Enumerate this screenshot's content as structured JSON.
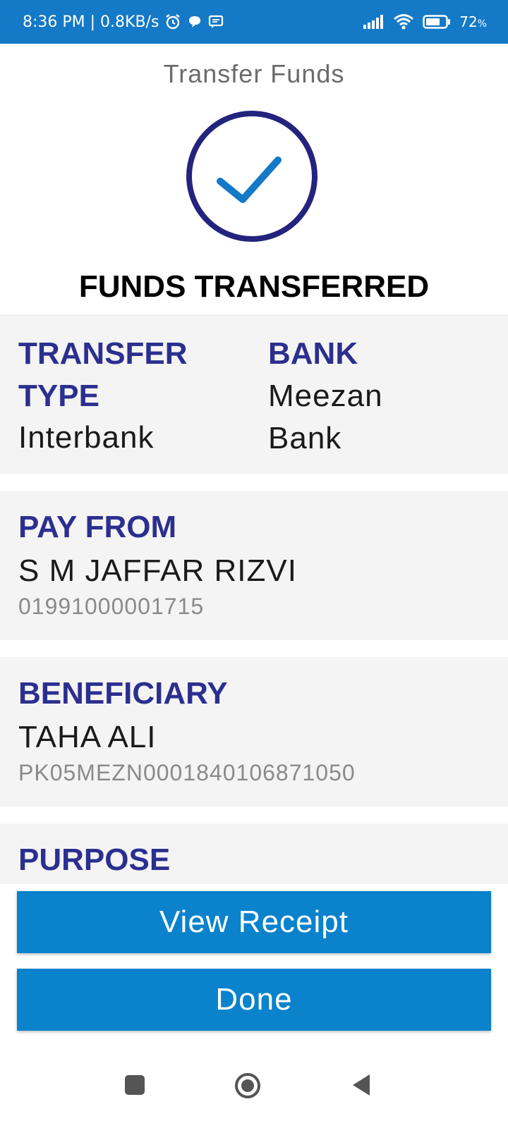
{
  "status_bar": {
    "time_speed": "8:36 PM | 0.8KB/s",
    "battery": "72",
    "battery_unit": "%"
  },
  "header": {
    "title": "Transfer Funds"
  },
  "success": {
    "headline": "FUNDS TRANSFERRED",
    "icon": "check-circle-icon"
  },
  "details": {
    "transfer_type_label_line1": "TRANSFER",
    "transfer_type_label_line2": "TYPE",
    "transfer_type_value": "Interbank",
    "bank_label": "BANK",
    "bank_value_line1": "Meezan",
    "bank_value_line2": "Bank",
    "pay_from_label": "PAY FROM",
    "pay_from_name": "S M JAFFAR RIZVI",
    "pay_from_account": "01991000001715",
    "beneficiary_label": "BENEFICIARY",
    "beneficiary_name": "TAHA ALI",
    "beneficiary_iban": "PK05MEZN0001840106871050",
    "purpose_label": "PURPOSE"
  },
  "buttons": {
    "view_receipt": "View Receipt",
    "done": "Done"
  },
  "colors": {
    "status_bar": "#1479c6",
    "accent": "#0a82cc",
    "label": "#2c2f8f",
    "check_ring": "#24237e",
    "check_mark": "#1479c6"
  }
}
